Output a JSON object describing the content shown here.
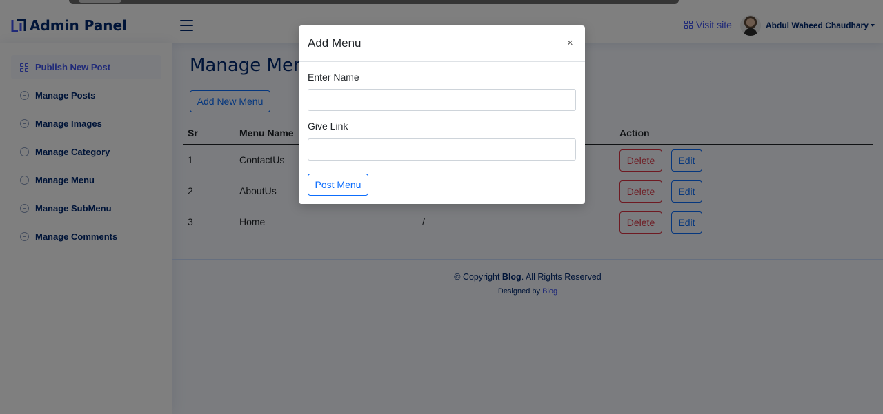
{
  "header": {
    "brand": "Admin Panel",
    "visit_site": "Visit site",
    "user_name": "Abdul Waheed Chaudhary"
  },
  "sidebar": {
    "items": [
      {
        "label": "Publish New Post",
        "icon": "grid-icon",
        "active": true
      },
      {
        "label": "Manage Posts",
        "icon": "dash-circle-icon"
      },
      {
        "label": "Manage Images",
        "icon": "dash-circle-icon"
      },
      {
        "label": "Manage Category",
        "icon": "dash-circle-icon"
      },
      {
        "label": "Manage Menu",
        "icon": "dash-circle-icon"
      },
      {
        "label": "Manage SubMenu",
        "icon": "dash-circle-icon"
      },
      {
        "label": "Manage Comments",
        "icon": "dash-circle-icon"
      }
    ]
  },
  "main": {
    "title": "Manage Menu",
    "add_button": "Add New Menu",
    "table": {
      "headers": {
        "sr": "Sr",
        "name": "Menu Name",
        "action": "Action"
      },
      "rows": [
        {
          "sr": "1",
          "name": "ContactUs",
          "link": ""
        },
        {
          "sr": "2",
          "name": "AboutUs",
          "link": ""
        },
        {
          "sr": "3",
          "name": "Home",
          "link": "/"
        }
      ],
      "delete_label": "Delete",
      "edit_label": "Edit"
    }
  },
  "footer": {
    "copyright_prefix": "© Copyright ",
    "brand": "Blog",
    "copyright_suffix": ". All Rights Reserved",
    "designed_by": "Designed by ",
    "designer": "Blog"
  },
  "modal": {
    "title": "Add Menu",
    "close": "×",
    "name_label": "Enter Name",
    "name_value": "",
    "link_label": "Give Link",
    "link_value": "",
    "submit": "Post Menu"
  },
  "colors": {
    "accent": "#4154f1",
    "navy": "#012970",
    "primary": "#0d6efd",
    "danger": "#dc3545"
  }
}
